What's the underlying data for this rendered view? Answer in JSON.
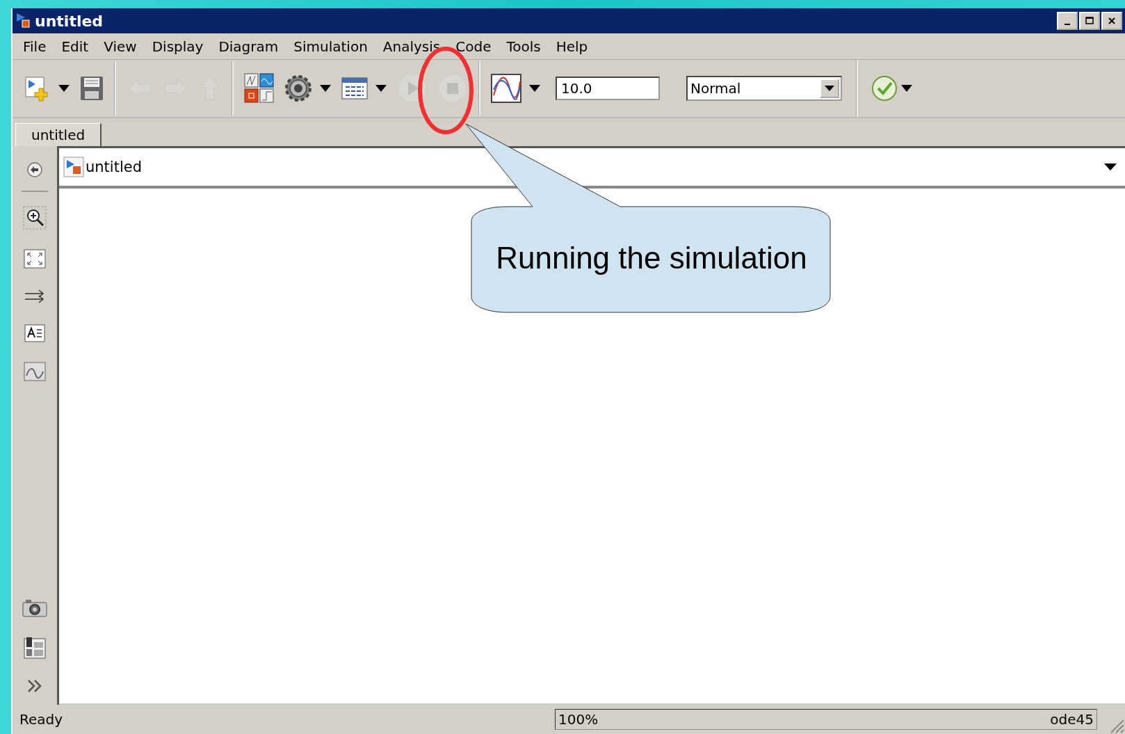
{
  "window": {
    "title": "untitled"
  },
  "menu": [
    {
      "label": "File"
    },
    {
      "label": "Edit"
    },
    {
      "label": "View"
    },
    {
      "label": "Display"
    },
    {
      "label": "Diagram"
    },
    {
      "label": "Simulation"
    },
    {
      "label": "Analysis"
    },
    {
      "label": "Code"
    },
    {
      "label": "Tools"
    },
    {
      "label": "Help"
    }
  ],
  "toolbar": {
    "buttons": [
      {
        "kind": "new",
        "disabled": false
      },
      {
        "kind": "caret"
      },
      {
        "kind": "save",
        "disabled": false
      },
      {
        "kind": "sep"
      },
      {
        "kind": "back",
        "disabled": true
      },
      {
        "kind": "forward",
        "disabled": true
      },
      {
        "kind": "up",
        "disabled": true
      },
      {
        "kind": "sep"
      },
      {
        "kind": "library",
        "disabled": false
      },
      {
        "kind": "gear",
        "disabled": false
      },
      {
        "kind": "caret"
      },
      {
        "kind": "explorer",
        "disabled": false
      },
      {
        "kind": "caret"
      },
      {
        "kind": "run",
        "disabled": true
      },
      {
        "kind": "stop",
        "disabled": true
      },
      {
        "kind": "sep"
      },
      {
        "kind": "scope",
        "disabled": false
      },
      {
        "kind": "caret"
      }
    ],
    "stop_time": "10.0",
    "mode": "Normal"
  },
  "tabs": [
    {
      "label": "untitled",
      "selected": true
    }
  ],
  "breadcrumb": {
    "path": "untitled"
  },
  "callout": {
    "text": "Running the simulation"
  },
  "status_bar": {
    "status": "Ready",
    "zoom": "100%",
    "solver": "ode45"
  }
}
